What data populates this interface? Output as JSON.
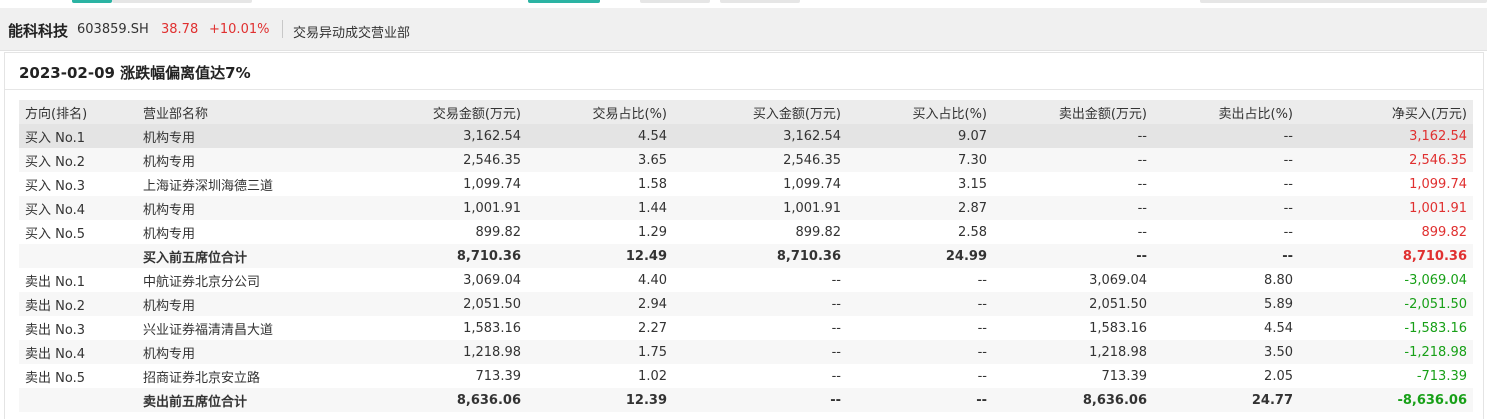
{
  "header": {
    "stock_name": "能科科技",
    "stock_code": "603859.SH",
    "price": "38.78",
    "change_pct": "+10.01%",
    "subtitle": "交易异动成交营业部"
  },
  "panel": {
    "title": "2023-02-09 涨跌幅偏离值达7%"
  },
  "table": {
    "columns": [
      "方向(排名)",
      "营业部名称",
      "交易金额(万元)",
      "交易占比(%)",
      "买入金额(万元)",
      "买入占比(%)",
      "卖出金额(万元)",
      "卖出占比(%)",
      "净买入(万元)"
    ],
    "rows": [
      {
        "rank": "买入 No.1",
        "name": "机构专用",
        "amount": "3,162.54",
        "amount_pct": "4.54",
        "buy": "3,162.54",
        "buy_pct": "9.07",
        "sell": "--",
        "sell_pct": "--",
        "net": "3,162.54"
      },
      {
        "rank": "买入 No.2",
        "name": "机构专用",
        "amount": "2,546.35",
        "amount_pct": "3.65",
        "buy": "2,546.35",
        "buy_pct": "7.30",
        "sell": "--",
        "sell_pct": "--",
        "net": "2,546.35"
      },
      {
        "rank": "买入 No.3",
        "name": "上海证券深圳海德三道",
        "amount": "1,099.74",
        "amount_pct": "1.58",
        "buy": "1,099.74",
        "buy_pct": "3.15",
        "sell": "--",
        "sell_pct": "--",
        "net": "1,099.74"
      },
      {
        "rank": "买入 No.4",
        "name": "机构专用",
        "amount": "1,001.91",
        "amount_pct": "1.44",
        "buy": "1,001.91",
        "buy_pct": "2.87",
        "sell": "--",
        "sell_pct": "--",
        "net": "1,001.91"
      },
      {
        "rank": "买入 No.5",
        "name": "机构专用",
        "amount": "899.82",
        "amount_pct": "1.29",
        "buy": "899.82",
        "buy_pct": "2.58",
        "sell": "--",
        "sell_pct": "--",
        "net": "899.82"
      },
      {
        "rank": "",
        "name": "买入前五席位合计",
        "amount": "8,710.36",
        "amount_pct": "12.49",
        "buy": "8,710.36",
        "buy_pct": "24.99",
        "sell": "--",
        "sell_pct": "--",
        "net": "8,710.36"
      },
      {
        "rank": "卖出 No.1",
        "name": "中航证券北京分公司",
        "amount": "3,069.04",
        "amount_pct": "4.40",
        "buy": "--",
        "buy_pct": "--",
        "sell": "3,069.04",
        "sell_pct": "8.80",
        "net": "-3,069.04"
      },
      {
        "rank": "卖出 No.2",
        "name": "机构专用",
        "amount": "2,051.50",
        "amount_pct": "2.94",
        "buy": "--",
        "buy_pct": "--",
        "sell": "2,051.50",
        "sell_pct": "5.89",
        "net": "-2,051.50"
      },
      {
        "rank": "卖出 No.3",
        "name": "兴业证券福清清昌大道",
        "amount": "1,583.16",
        "amount_pct": "2.27",
        "buy": "--",
        "buy_pct": "--",
        "sell": "1,583.16",
        "sell_pct": "4.54",
        "net": "-1,583.16"
      },
      {
        "rank": "卖出 No.4",
        "name": "机构专用",
        "amount": "1,218.98",
        "amount_pct": "1.75",
        "buy": "--",
        "buy_pct": "--",
        "sell": "1,218.98",
        "sell_pct": "3.50",
        "net": "-1,218.98"
      },
      {
        "rank": "卖出 No.5",
        "name": "招商证券北京安立路",
        "amount": "713.39",
        "amount_pct": "1.02",
        "buy": "--",
        "buy_pct": "--",
        "sell": "713.39",
        "sell_pct": "2.05",
        "net": "-713.39"
      },
      {
        "rank": "",
        "name": "卖出前五席位合计",
        "amount": "8,636.06",
        "amount_pct": "12.39",
        "buy": "--",
        "buy_pct": "--",
        "sell": "8,636.06",
        "sell_pct": "24.77",
        "net": "-8,636.06"
      }
    ]
  },
  "colors": {
    "up": "#e03030",
    "down": "#18a018",
    "accent": "#2bb3a3"
  }
}
